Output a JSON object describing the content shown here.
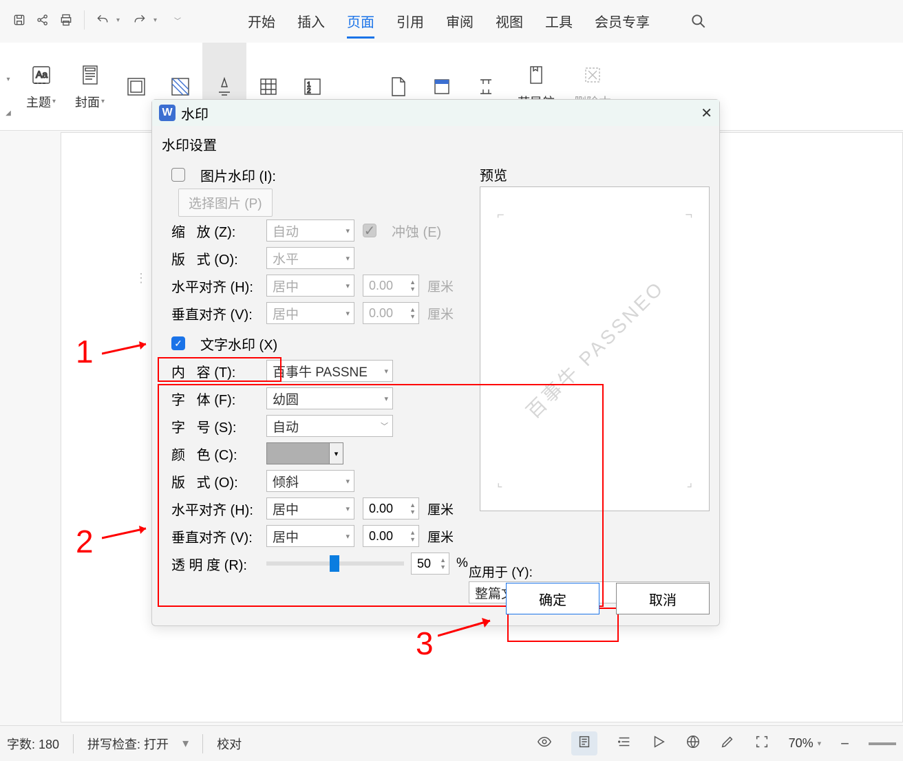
{
  "menu": {
    "items": [
      "开始",
      "插入",
      "页面",
      "引用",
      "审阅",
      "视图",
      "工具",
      "会员专享"
    ],
    "active": 2
  },
  "ribbon": {
    "theme": "主题",
    "cover": "封面",
    "chapter_nav": "节导航",
    "delete": "删除本"
  },
  "dialog": {
    "title": "水印",
    "group": "水印设置",
    "img_wm": "图片水印 (I):",
    "select_pic": "选择图片 (P)",
    "scale_lbl": "缩   放 (Z):",
    "scale_val": "自动",
    "washout": "冲蚀 (E)",
    "layout1_lbl": "版   式 (O):",
    "layout1_val": "水平",
    "halign1_lbl": "水平对齐 (H):",
    "halign1_val": "居中",
    "halign1_off": "0.00",
    "unit_cm": "厘米",
    "valign1_lbl": "垂直对齐 (V):",
    "valign1_val": "居中",
    "valign1_off": "0.00",
    "txt_wm": "文字水印 (X)",
    "content_lbl": "内   容 (T):",
    "content_val": "百事牛 PASSNE",
    "font_lbl": "字   体 (F):",
    "font_val": "幼圆",
    "size_lbl": "字   号 (S):",
    "size_val": "自动",
    "color_lbl": "颜   色 (C):",
    "layout2_lbl": "版   式 (O):",
    "layout2_val": "倾斜",
    "halign2_lbl": "水平对齐 (H):",
    "halign2_val": "居中",
    "halign2_off": "0.00",
    "valign2_lbl": "垂直对齐 (V):",
    "valign2_val": "居中",
    "valign2_off": "0.00",
    "opacity_lbl": "透 明 度 (R):",
    "opacity_val": "50",
    "opacity_unit": "%",
    "preview_lbl": "预览",
    "preview_wm": "百事牛 PASSNEO",
    "apply_lbl": "应用于 (Y):",
    "apply_val": "整篇文档",
    "ok": "确定",
    "cancel": "取消"
  },
  "anno": {
    "n1": "1",
    "n2": "2",
    "n3": "3"
  },
  "status": {
    "wc": "字数: 180",
    "spell": "拼写检查: 打开",
    "proof": "校对",
    "zoom": "70%"
  }
}
